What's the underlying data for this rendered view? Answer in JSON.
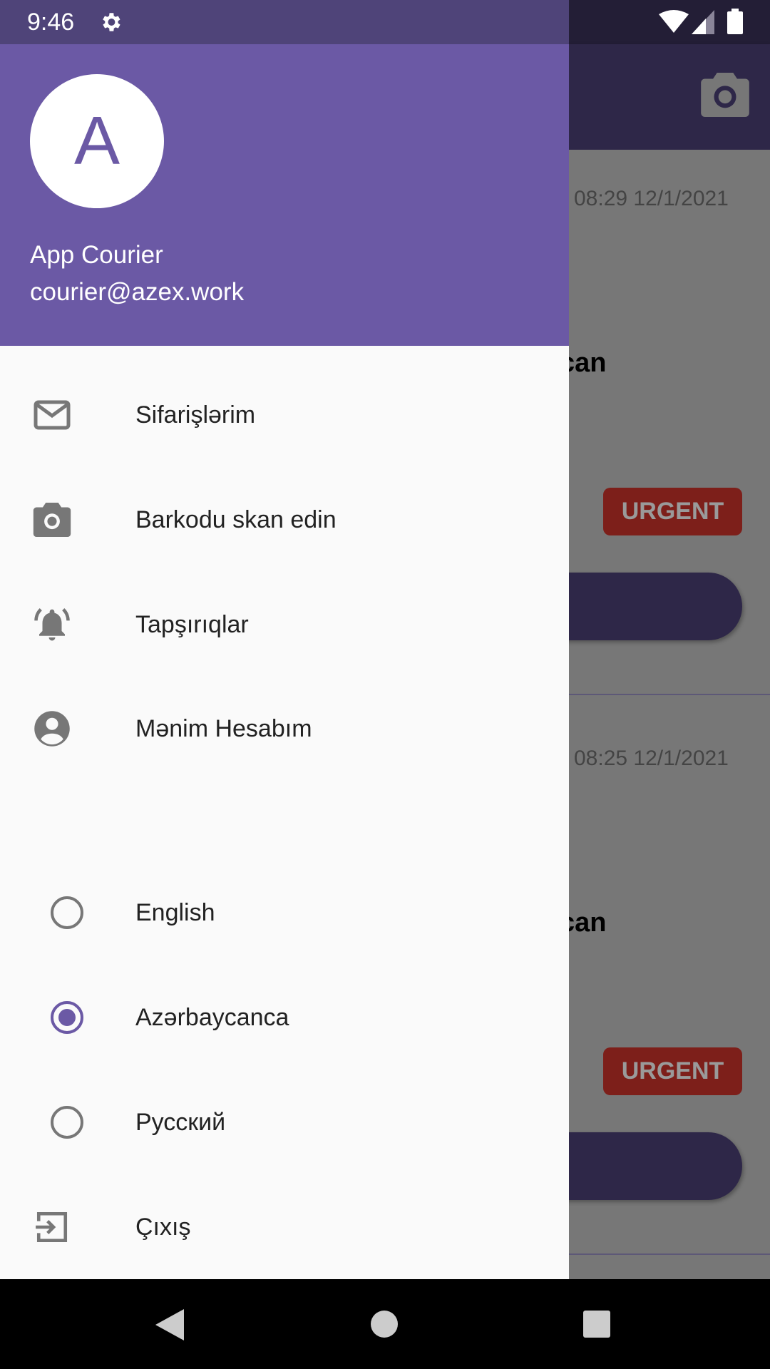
{
  "status_bar": {
    "time": "9:46",
    "icons": [
      "settings-icon",
      "wifi-icon",
      "signal-icon",
      "battery-icon"
    ]
  },
  "app_bar": {
    "action_icon": "camera-icon"
  },
  "orders": [
    {
      "timestamp": "08:29 12/1/2021",
      "title_fragment": "can",
      "badge": "URGENT"
    },
    {
      "timestamp": "08:25 12/1/2021",
      "title_fragment": "can",
      "badge": "URGENT"
    }
  ],
  "drawer": {
    "avatar_letter": "A",
    "user_name": "App Courier",
    "user_email": "courier@azex.work",
    "items": [
      {
        "label": "Sifarişlərim",
        "icon": "mail-icon"
      },
      {
        "label": "Barkodu skan edin",
        "icon": "camera-icon"
      },
      {
        "label": "Tapşırıqlar",
        "icon": "bell-icon"
      },
      {
        "label": "Mənim Hesabım",
        "icon": "account-icon"
      }
    ],
    "languages": [
      {
        "label": "English",
        "selected": false
      },
      {
        "label": "Azərbaycanca",
        "selected": true
      },
      {
        "label": "Русский",
        "selected": false
      }
    ],
    "logout": {
      "label": "Çıxış",
      "icon": "logout-icon"
    }
  },
  "colors": {
    "primary": "#6b59a5",
    "urgent": "#c62828"
  }
}
